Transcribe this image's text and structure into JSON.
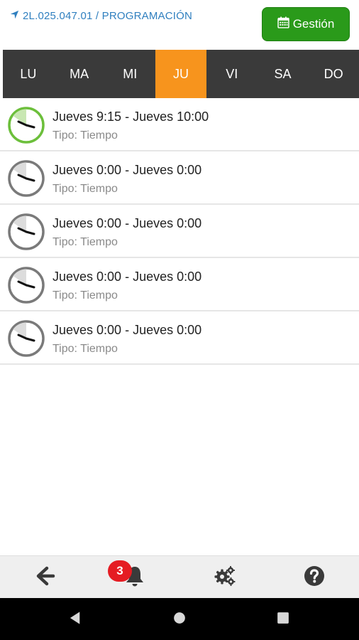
{
  "header": {
    "breadcrumb": "2L.025.047.01 / PROGRAMACIÓN",
    "breadcrumb_icon": "location-arrow-icon",
    "gestion_button": {
      "label": "Gestión",
      "icon": "calendar-icon",
      "color": "#2a9a1a"
    }
  },
  "days": {
    "active_color": "#f7941d",
    "bar_color": "#3a3a3a",
    "items": [
      {
        "label": "LU",
        "active": false
      },
      {
        "label": "MA",
        "active": false
      },
      {
        "label": "MI",
        "active": false
      },
      {
        "label": "JU",
        "active": true
      },
      {
        "label": "VI",
        "active": false
      },
      {
        "label": "SA",
        "active": false
      },
      {
        "label": "DO",
        "active": false
      }
    ]
  },
  "schedule": [
    {
      "title": "Jueves 9:15 - Jueves 10:00",
      "type": "Tipo: Tiempo",
      "state": "active",
      "ring_color": "#6cbf3b"
    },
    {
      "title": "Jueves 0:00 - Jueves 0:00",
      "type": "Tipo: Tiempo",
      "state": "inactive",
      "ring_color": "#7a7a7a"
    },
    {
      "title": "Jueves 0:00 - Jueves 0:00",
      "type": "Tipo: Tiempo",
      "state": "inactive",
      "ring_color": "#7a7a7a"
    },
    {
      "title": "Jueves 0:00 - Jueves 0:00",
      "type": "Tipo: Tiempo",
      "state": "inactive",
      "ring_color": "#7a7a7a"
    },
    {
      "title": "Jueves 0:00 - Jueves 0:00",
      "type": "Tipo: Tiempo",
      "state": "inactive",
      "ring_color": "#7a7a7a"
    }
  ],
  "toolbar": {
    "back_icon": "arrow-left-icon",
    "notifications_icon": "bell-icon",
    "notifications_count": "3",
    "settings_icon": "gears-icon",
    "help_icon": "question-circle-icon"
  },
  "system_nav": {
    "back_icon": "triangle-back-icon",
    "home_icon": "circle-home-icon",
    "recents_icon": "square-recents-icon"
  }
}
